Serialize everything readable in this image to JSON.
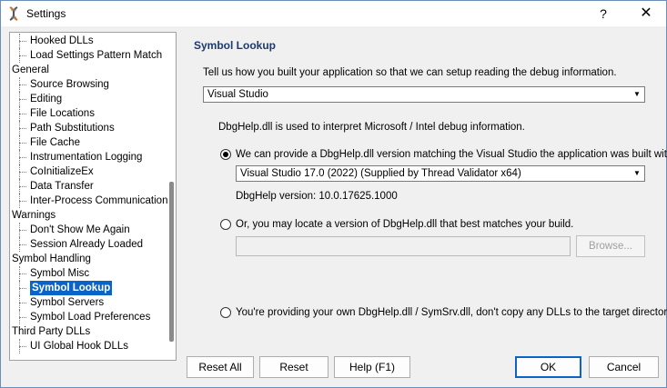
{
  "window": {
    "title": "Settings",
    "help_glyph": "?",
    "close_glyph": "✕"
  },
  "tree": {
    "items": [
      {
        "label": "Hooked DLLs",
        "level": 1
      },
      {
        "label": "Load Settings Pattern Match",
        "level": 1
      },
      {
        "label": "General",
        "level": 0
      },
      {
        "label": "Source Browsing",
        "level": 1
      },
      {
        "label": "Editing",
        "level": 1
      },
      {
        "label": "File Locations",
        "level": 1
      },
      {
        "label": "Path Substitutions",
        "level": 1
      },
      {
        "label": "File Cache",
        "level": 1
      },
      {
        "label": "Instrumentation Logging",
        "level": 1
      },
      {
        "label": "CoInitializeEx",
        "level": 1
      },
      {
        "label": "Data Transfer",
        "level": 1
      },
      {
        "label": "Inter-Process Communication",
        "level": 1
      },
      {
        "label": "Warnings",
        "level": 0
      },
      {
        "label": "Don't Show Me Again",
        "level": 1
      },
      {
        "label": "Session Already Loaded",
        "level": 1
      },
      {
        "label": "Symbol Handling",
        "level": 0
      },
      {
        "label": "Symbol Misc",
        "level": 1
      },
      {
        "label": "Symbol Lookup",
        "level": 1,
        "selected": true
      },
      {
        "label": "Symbol Servers",
        "level": 1
      },
      {
        "label": "Symbol Load Preferences",
        "level": 1
      },
      {
        "label": "Third Party DLLs",
        "level": 0
      },
      {
        "label": "UI Global Hook DLLs",
        "level": 1
      }
    ]
  },
  "panel": {
    "title": "Symbol Lookup",
    "description": "Tell us how you built your application so that we can setup reading the debug information.",
    "build_select": "Visual Studio",
    "dbghelp_info": "DbgHelp.dll is used to interpret Microsoft / Intel debug information.",
    "option1_label": "We can provide a DbgHelp.dll version matching the Visual Studio the application was built with.",
    "version_select": "Visual Studio 17.0 (2022) (Supplied by  Thread Validator x64)",
    "dbghelp_version": "DbgHelp version: 10.0.17625.1000",
    "option2_label": "Or, you may locate a version of DbgHelp.dll that best matches your build.",
    "path_value": "",
    "browse_label": "Browse...",
    "option3_label": "You're providing your own DbgHelp.dll / SymSrv.dll, don't copy any DLLs to the target directory",
    "selected_option": 1
  },
  "buttons": {
    "reset_all": "Reset All",
    "reset": "Reset",
    "help": "Help (F1)",
    "ok": "OK",
    "cancel": "Cancel"
  }
}
